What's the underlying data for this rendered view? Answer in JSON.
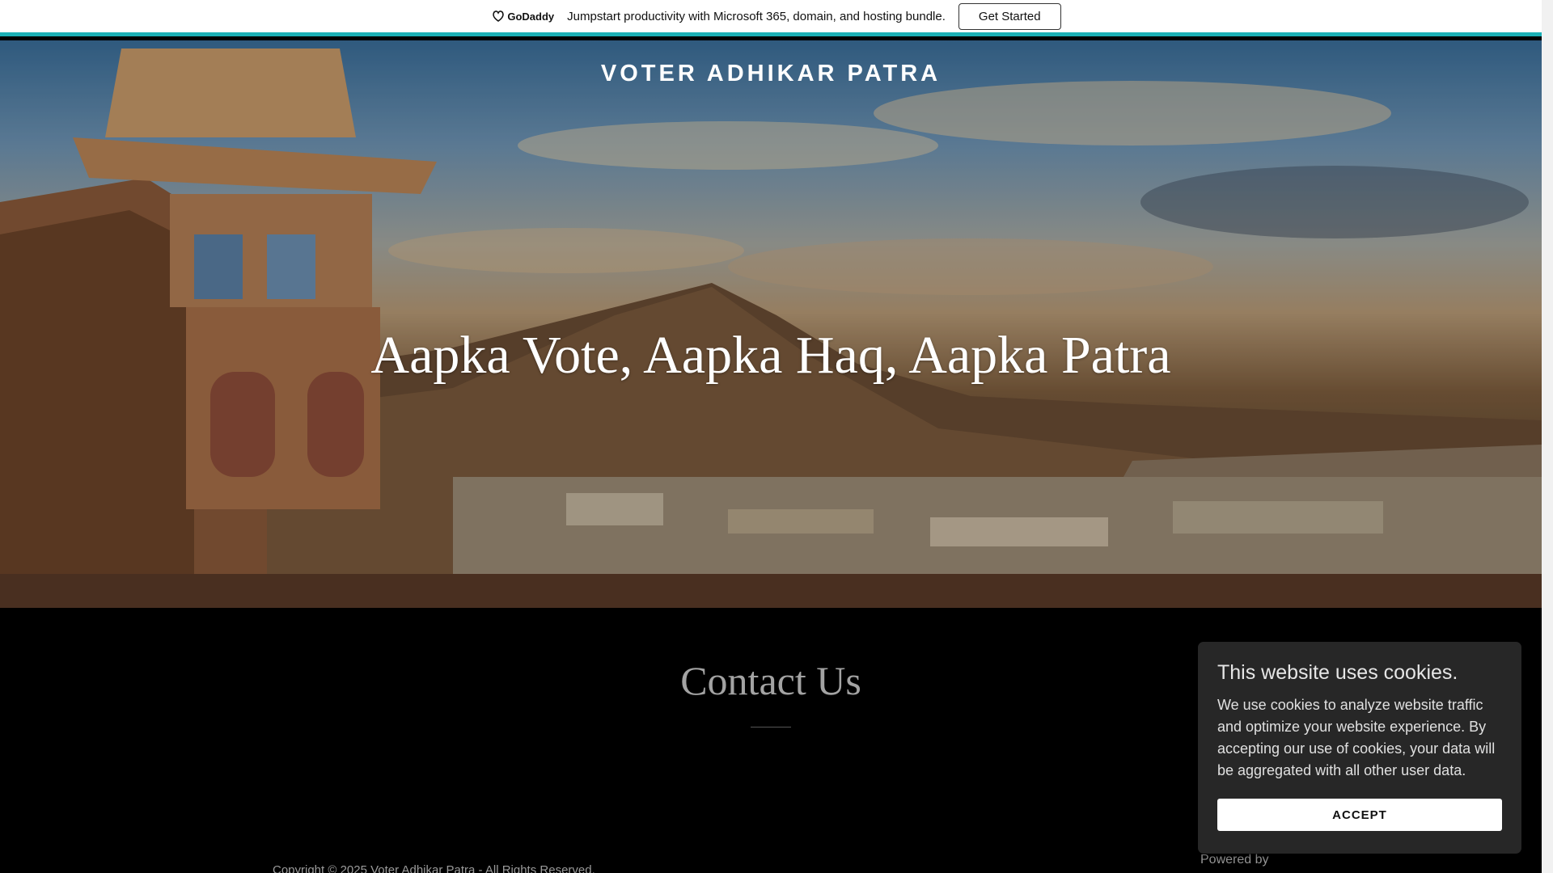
{
  "promo": {
    "brand": "GoDaddy",
    "text": "Jumpstart productivity with Microsoft 365, domain, and hosting bundle.",
    "button_label": "Get Started",
    "accent": "#1bb0b6"
  },
  "hero": {
    "site_title": "VOTER ADHIKAR PATRA",
    "tagline": "Aapka Vote, Aapka Haq, Aapka Patra"
  },
  "contact": {
    "heading": "Contact Us"
  },
  "footer": {
    "copyright": "Copyright © 2025 Voter Adhikar Patra - All Rights Reserved.",
    "powered_by": "Powered by"
  },
  "cookie_banner": {
    "title": "This website uses cookies.",
    "body": "We use cookies to analyze website traffic and optimize your website experience. By accepting our use of cookies, your data will be aggregated with all other user data.",
    "accept_label": "ACCEPT"
  }
}
